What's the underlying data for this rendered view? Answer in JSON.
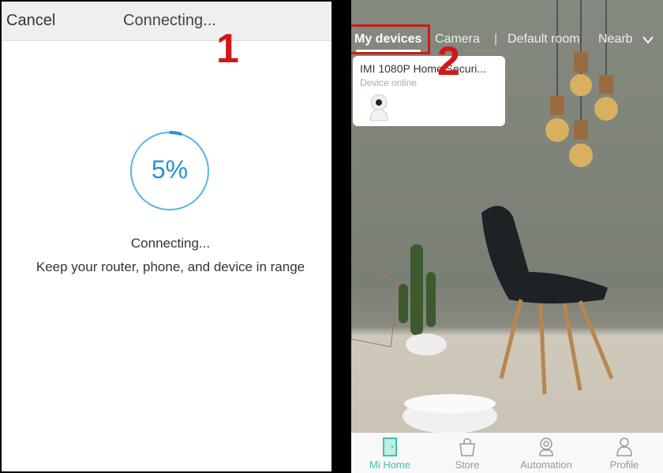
{
  "left": {
    "cancel_label": "Cancel",
    "title": "Connecting...",
    "progress_percent": 5,
    "progress_label": "5%",
    "status": "Connecting...",
    "hint": "Keep your router, phone, and device in range",
    "accent": "#5ab4e0"
  },
  "right": {
    "tabs": [
      "My devices",
      "Camera",
      "Default room",
      "Nearb"
    ],
    "separator": "|",
    "device": {
      "name": "IMI 1080P Home Securi...",
      "status": "Device online",
      "icon": "camera-icon"
    },
    "nav": [
      {
        "label": "Mi Home",
        "icon": "door-icon",
        "active": true
      },
      {
        "label": "Store",
        "icon": "bag-icon"
      },
      {
        "label": "Automation",
        "icon": "webcam-icon"
      },
      {
        "label": "Profile",
        "icon": "person-icon"
      }
    ],
    "active_color": "#3cc4a8"
  },
  "annotations": [
    "1",
    "2"
  ],
  "annotation_color": "#d01818"
}
